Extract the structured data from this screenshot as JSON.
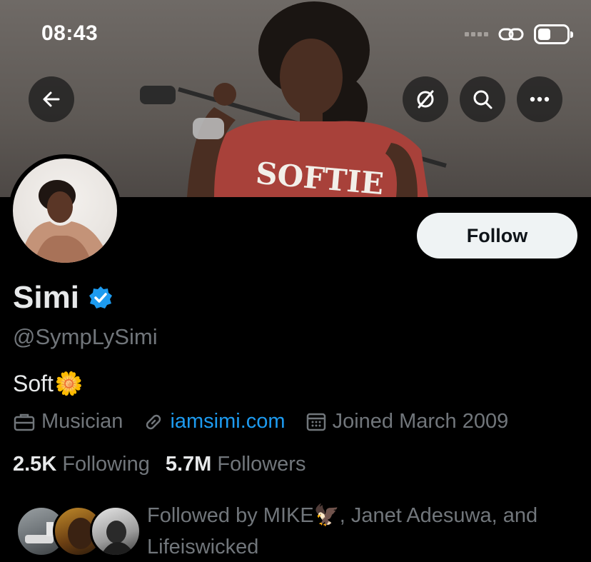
{
  "status_bar": {
    "time": "08:43"
  },
  "header": {
    "back_label": "Back",
    "icons": [
      "back-arrow-icon",
      "grok-icon",
      "search-icon",
      "more-icon"
    ]
  },
  "profile": {
    "name": "Simi",
    "verified": true,
    "handle": "@SympLySimi",
    "bio": "Soft",
    "bio_emoji": "🌼",
    "follow_label": "Follow",
    "meta": {
      "category": "Musician",
      "website": "iamsimi.com",
      "joined": "Joined March 2009"
    },
    "stats": {
      "following_count": "2.5K",
      "following_label": "Following",
      "followers_count": "5.7M",
      "followers_label": "Followers"
    },
    "followed_by": "Followed by MIKE🦅, Janet Adesuwa, and Lifeiswicked"
  },
  "colors": {
    "background": "#000000",
    "primary_text": "#e7e9ea",
    "secondary_text": "#71767b",
    "link": "#1d9bf0",
    "verified_badge": "#1d9bf0",
    "follow_button_bg": "#eff3f4"
  }
}
